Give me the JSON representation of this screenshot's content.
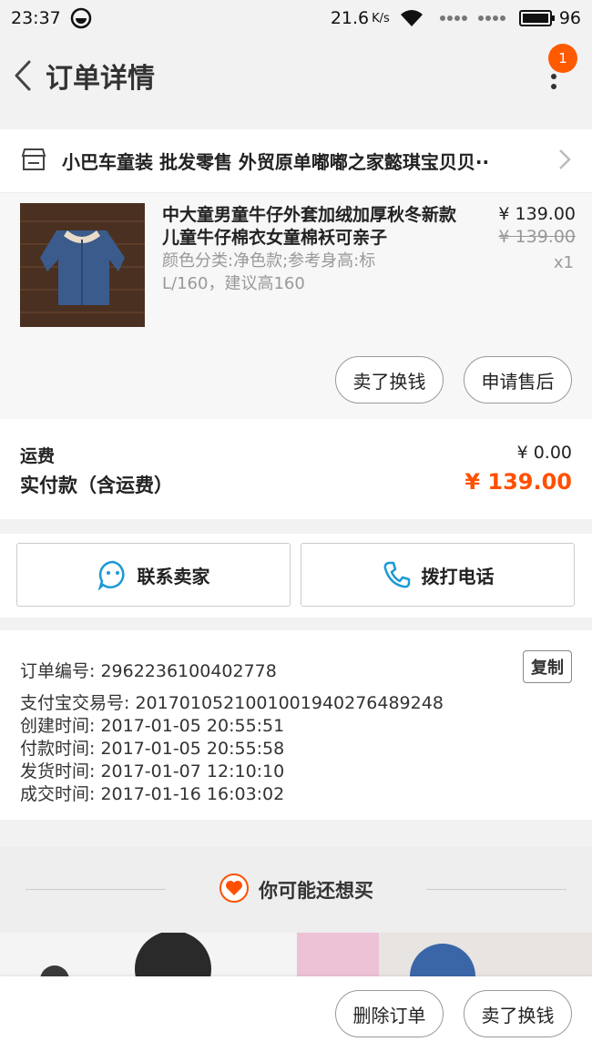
{
  "status": {
    "time": "23:37",
    "speed": "21.6",
    "speed_unit": "K/s",
    "battery": "96"
  },
  "header": {
    "title": "订单详情",
    "badge": "1"
  },
  "shop": {
    "name": "小巴车童装 批发零售 外贸原单嘟嘟之家懿琪宝贝贝··"
  },
  "product": {
    "name": "中大童男童牛仔外套加绒加厚秋冬新款儿童牛仔棉衣女童棉袄可亲子",
    "sku": "颜色分类:净色款;参考身高:标L/160，建议高160",
    "price": "¥ 139.00",
    "old_price": "¥ 139.00",
    "qty": "x1",
    "btn_resell": "卖了换钱",
    "btn_aftersale": "申请售后"
  },
  "payment": {
    "shipping_label": "运费",
    "shipping_value": "¥ 0.00",
    "total_label": "实付款（含运费）",
    "total_value": "¥ 139.00"
  },
  "contact": {
    "seller_label": "联系卖家",
    "call_label": "拨打电话"
  },
  "order_info": {
    "copy_label": "复制",
    "rows": [
      "订单编号: 2962236100402778",
      "支付宝交易号: 2017010521001001940276489248",
      "创建时间: 2017-01-05 20:55:51",
      "付款时间: 2017-01-05 20:55:58",
      "发货时间: 2017-01-07 12:10:10",
      "成交时间: 2017-01-16 16:03:02"
    ]
  },
  "recommend": {
    "title": "你可能还想买"
  },
  "bottom": {
    "delete_label": "删除订单",
    "resell_label": "卖了换钱"
  },
  "colors": {
    "accent": "#ff5000",
    "badge": "#ff5a00",
    "contact_icon": "#1a9ad6"
  }
}
